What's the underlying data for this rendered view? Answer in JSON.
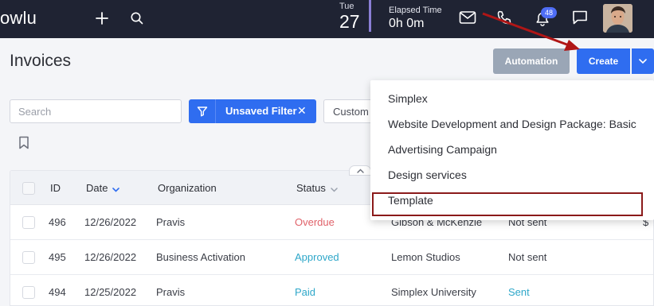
{
  "topbar": {
    "logo": "owlu",
    "date_day": "Tue",
    "date_num": "27",
    "elapsed_label": "Elapsed Time",
    "elapsed_value": "0h 0m",
    "notification_count": "48",
    "icons": [
      "plus-icon",
      "search-icon",
      "mail-icon",
      "phone-icon",
      "bell-icon",
      "chat-icon"
    ]
  },
  "page": {
    "title": "Invoices",
    "automation_label": "Automation",
    "create_label": "Create"
  },
  "filters": {
    "search_placeholder": "Search",
    "chip_label": "Unsaved Filter",
    "chip_close": "✕",
    "custom_select": "Custom"
  },
  "table": {
    "headers": [
      "ID",
      "Date",
      "Organization",
      "Status"
    ],
    "rows": [
      {
        "id": "496",
        "date": "12/26/2022",
        "org": "Pravis",
        "status": "Overdue",
        "client": "Gibson & McKenzie",
        "sent": "Not sent",
        "extra": "$"
      },
      {
        "id": "495",
        "date": "12/26/2022",
        "org": "Business Activation",
        "status": "Approved",
        "client": "Lemon Studios",
        "sent": "Not sent",
        "extra": ""
      },
      {
        "id": "494",
        "date": "12/25/2022",
        "org": "Pravis",
        "status": "Paid",
        "client": "Simplex University",
        "sent": "Sent",
        "extra": ""
      }
    ]
  },
  "dropdown": {
    "items": [
      "Simplex",
      "Website Development and Design Package: Basic",
      "Advertising Campaign",
      "Design services",
      "Template"
    ]
  },
  "colors": {
    "overdue": "#e0626a",
    "approved": "#2ea7c9",
    "paid": "#2ea7c9",
    "sent": "#2ea7c9",
    "primary": "#2f6df0",
    "highlight": "#8b1a1a"
  }
}
